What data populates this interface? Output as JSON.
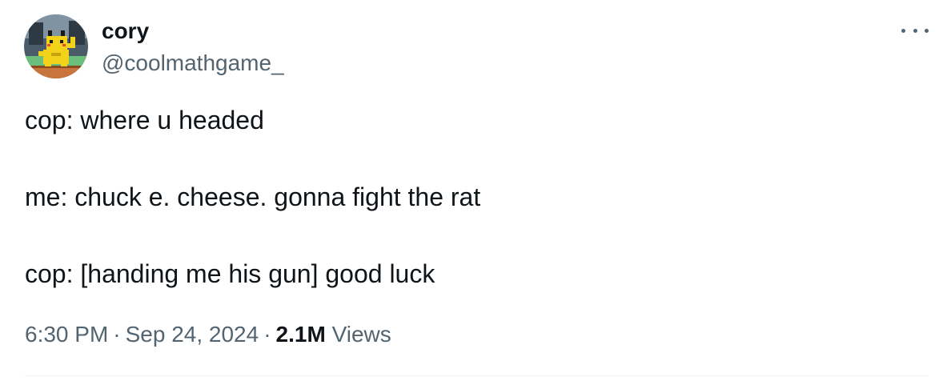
{
  "author": {
    "display_name": "cory",
    "handle": "@coolmathgame_",
    "avatar": "pikachu-pixel-art"
  },
  "tweet": {
    "lines": [
      "cop: where u headed",
      "me: chuck e. cheese. gonna fight the rat",
      "cop: [handing me his gun] good luck"
    ]
  },
  "meta": {
    "time": "6:30 PM",
    "separator": "·",
    "date": "Sep 24, 2024",
    "views_count": "2.1M",
    "views_label": "Views"
  },
  "icons": {
    "more": "more-horizontal-icon"
  },
  "colors": {
    "primary_text": "#0f1419",
    "secondary_text": "#536471",
    "divider": "#eff3f4"
  }
}
